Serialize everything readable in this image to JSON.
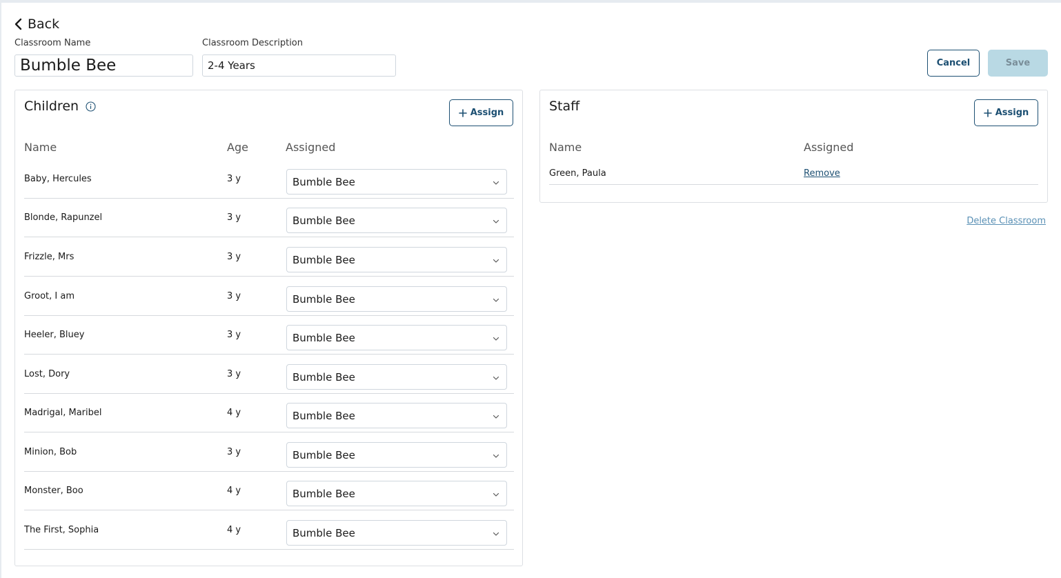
{
  "back": {
    "label": "Back"
  },
  "form": {
    "name_label": "Classroom Name",
    "name_value": "Bumble Bee",
    "desc_label": "Classroom Description",
    "desc_value": "2-4 Years"
  },
  "actions": {
    "cancel": "Cancel",
    "save": "Save"
  },
  "children": {
    "title": "Children",
    "assign": "Assign",
    "headers": {
      "name": "Name",
      "age": "Age",
      "assigned": "Assigned"
    },
    "rows": [
      {
        "name": "Baby, Hercules",
        "age": "3 y",
        "assigned": "Bumble Bee"
      },
      {
        "name": "Blonde, Rapunzel",
        "age": "3 y",
        "assigned": "Bumble Bee"
      },
      {
        "name": "Frizzle, Mrs",
        "age": "3 y",
        "assigned": "Bumble Bee"
      },
      {
        "name": "Groot, I am",
        "age": "3 y",
        "assigned": "Bumble Bee"
      },
      {
        "name": "Heeler, Bluey",
        "age": "3 y",
        "assigned": "Bumble Bee"
      },
      {
        "name": "Lost, Dory",
        "age": "3 y",
        "assigned": "Bumble Bee"
      },
      {
        "name": "Madrigal, Maribel",
        "age": "4 y",
        "assigned": "Bumble Bee"
      },
      {
        "name": "Minion, Bob",
        "age": "3 y",
        "assigned": "Bumble Bee"
      },
      {
        "name": "Monster, Boo",
        "age": "4 y",
        "assigned": "Bumble Bee"
      },
      {
        "name": "The First, Sophia",
        "age": "4 y",
        "assigned": "Bumble Bee"
      }
    ]
  },
  "staff": {
    "title": "Staff",
    "assign": "Assign",
    "headers": {
      "name": "Name",
      "assigned": "Assigned"
    },
    "rows": [
      {
        "name": "Green, Paula",
        "action": "Remove"
      }
    ]
  },
  "delete_link": "Delete Classroom",
  "icons": {
    "back": "chevron-left-icon",
    "info": "info-icon",
    "plus": "plus-icon",
    "dropdown": "chevron-down-icon"
  },
  "colors": {
    "accent": "#1c4f72",
    "save_disabled_bg": "#b9d9e4",
    "link_muted": "#5a90b5"
  }
}
